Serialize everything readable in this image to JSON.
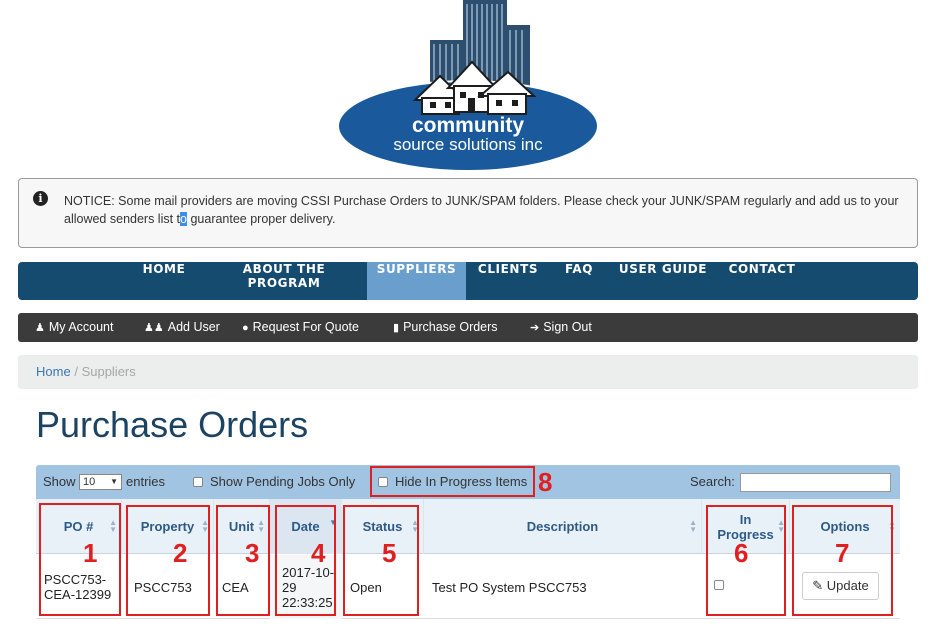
{
  "logo": {
    "line1": "community",
    "line2": "source solutions inc"
  },
  "notice": {
    "before": "NOTICE: Some mail providers are moving CSSI Purchase Orders to JUNK/SPAM folders. Please check your JUNK/SPAM regularly and add us to your allowed senders list t",
    "selected": "o",
    "after": " guarantee proper delivery."
  },
  "main_nav": [
    "HOME",
    "ABOUT THE PROGRAM",
    "SUPPLIERS",
    "CLIENTS",
    "FAQ",
    "USER GUIDE",
    "CONTACT"
  ],
  "main_nav_active": "SUPPLIERS",
  "sub_nav": [
    "My Account",
    "Add User",
    "Request For Quote",
    "Purchase Orders",
    "Sign Out"
  ],
  "breadcrumb": {
    "home": "Home",
    "sep": "/",
    "current": "Suppliers"
  },
  "page_title": "Purchase Orders",
  "controls": {
    "show": "Show",
    "entries_value": "10",
    "entries": "entries",
    "pending_label": "Show Pending Jobs Only",
    "hide_label": "Hide In Progress Items",
    "search_label": "Search:"
  },
  "columns": [
    "PO #",
    "Property",
    "Unit",
    "Date",
    "Status",
    "Description",
    "In Progress",
    "Options"
  ],
  "rows": [
    {
      "po": "PSCC753-CEA-12399",
      "property": "PSCC753",
      "unit": "CEA",
      "date": "2017-10-29 22:33:25",
      "status": "Open",
      "description": "Test PO System PSCC753",
      "update_label": "Update"
    }
  ],
  "annotations": [
    "1",
    "2",
    "3",
    "4",
    "5",
    "6",
    "7",
    "8"
  ],
  "colors": {
    "nav": "#164b70",
    "nav_active": "#6a9fcd",
    "annotation": "#e02020",
    "title": "#1d4363"
  }
}
